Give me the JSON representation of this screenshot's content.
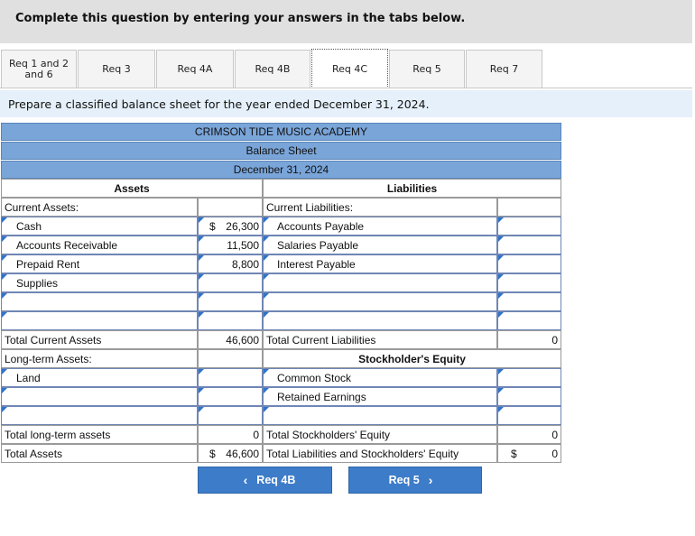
{
  "header": {
    "prompt": "Complete this question by entering your answers in the tabs below."
  },
  "tabs": [
    {
      "label": "Req 1 and 2 and 6"
    },
    {
      "label": "Req 3"
    },
    {
      "label": "Req 4A"
    },
    {
      "label": "Req 4B"
    },
    {
      "label": "Req 4C",
      "active": true
    },
    {
      "label": "Req 5"
    },
    {
      "label": "Req 7"
    }
  ],
  "instruction": "Prepare a classified balance sheet for the year ended December 31, 2024.",
  "sheet": {
    "company": "CRIMSON TIDE MUSIC ACADEMY",
    "title": "Balance Sheet",
    "date": "December 31, 2024",
    "assets_header": "Assets",
    "liabilities_header": "Liabilities",
    "current_assets_label": "Current Assets:",
    "current_liabilities_label": "Current Liabilities:",
    "rows": [
      {
        "asset": "Cash",
        "dollar": "$",
        "amount": "26,300",
        "liability": "Accounts Payable",
        "liab_amount": ""
      },
      {
        "asset": "Accounts Receivable",
        "amount": "11,500",
        "liability": "Salaries Payable",
        "liab_amount": ""
      },
      {
        "asset": "Prepaid Rent",
        "amount": "8,800",
        "liability": "Interest Payable",
        "liab_amount": ""
      },
      {
        "asset": "Supplies",
        "amount": "",
        "liability": "",
        "liab_amount": ""
      },
      {
        "asset": "",
        "amount": "",
        "liability": "",
        "liab_amount": ""
      },
      {
        "asset": "",
        "amount": "",
        "liability": "",
        "liab_amount": ""
      }
    ],
    "total_current_assets_label": "Total Current Assets",
    "total_current_assets": "46,600",
    "total_current_liabilities_label": "Total Current Liabilities",
    "total_current_liabilities": "0",
    "long_term_assets_label": "Long-term Assets:",
    "equity_header": "Stockholder's Equity",
    "land_label": "Land",
    "common_stock_label": "Common Stock",
    "retained_earnings_label": "Retained Earnings",
    "total_long_term_label": "Total long-term assets",
    "total_long_term": "0",
    "total_se_label": "Total Stockholders' Equity",
    "total_se": "0",
    "total_assets_label": "Total Assets",
    "total_assets_dollar": "$",
    "total_assets": "46,600",
    "total_le_label": "Total Liabilities and Stockholders' Equity",
    "total_le_dollar": "$",
    "total_le": "0"
  },
  "nav": {
    "prev_label": "Req 4B",
    "next_label": "Req 5"
  }
}
